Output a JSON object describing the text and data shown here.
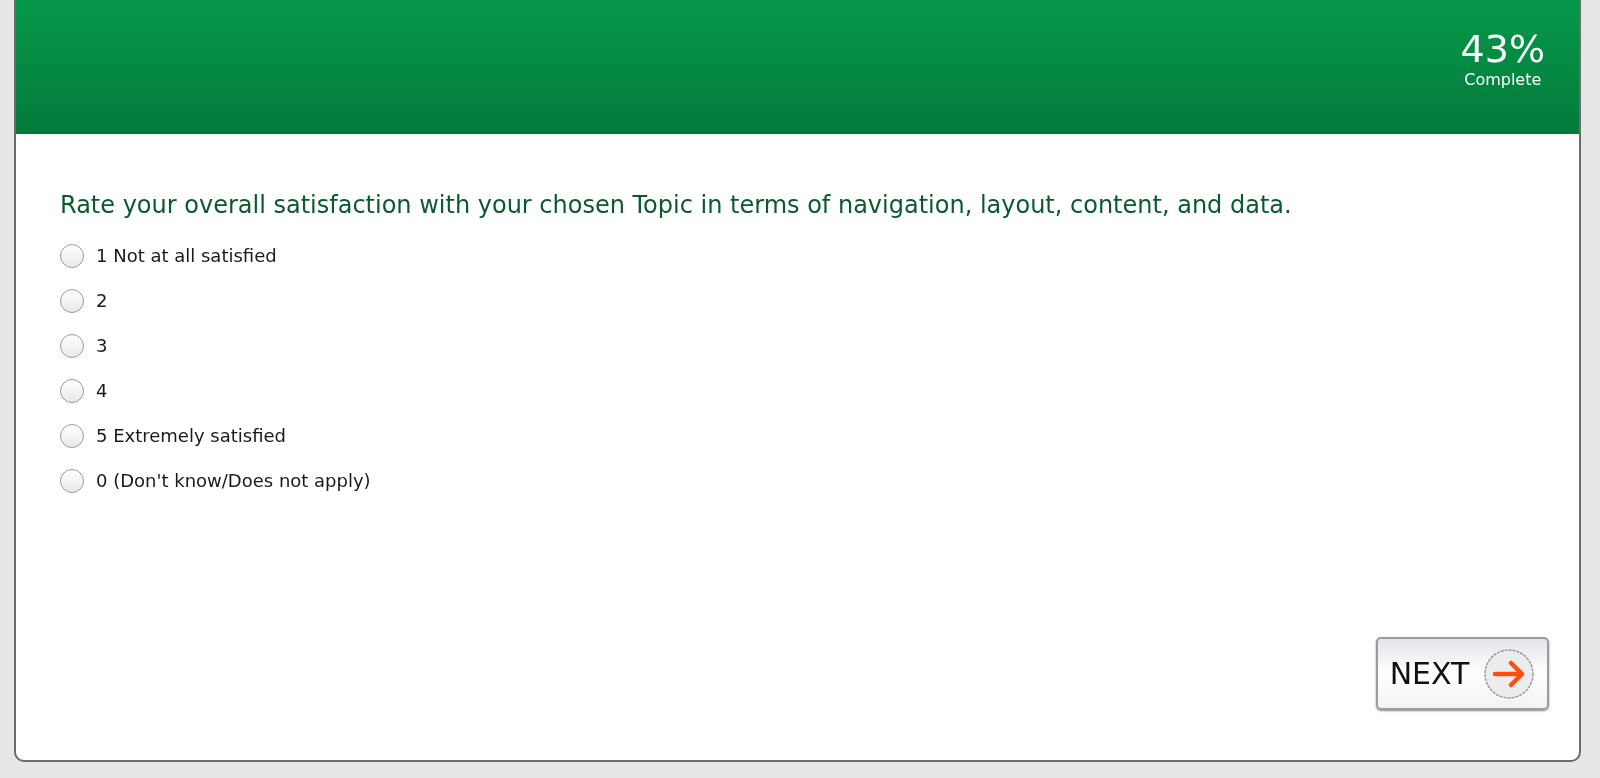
{
  "progress": {
    "percent": "43%",
    "label": "Complete"
  },
  "question": "Rate your overall satisfaction with your chosen Topic in terms of navigation, layout, content, and data.",
  "options": [
    {
      "label": "1 Not at all satisfied",
      "selected": false
    },
    {
      "label": "2",
      "selected": false
    },
    {
      "label": "3",
      "selected": false
    },
    {
      "label": "4",
      "selected": false
    },
    {
      "label": "5 Extremely satisfied",
      "selected": false
    },
    {
      "label": "0 (Don't know/Does not apply)",
      "selected": false
    }
  ],
  "next_button": {
    "label": "NEXT"
  }
}
